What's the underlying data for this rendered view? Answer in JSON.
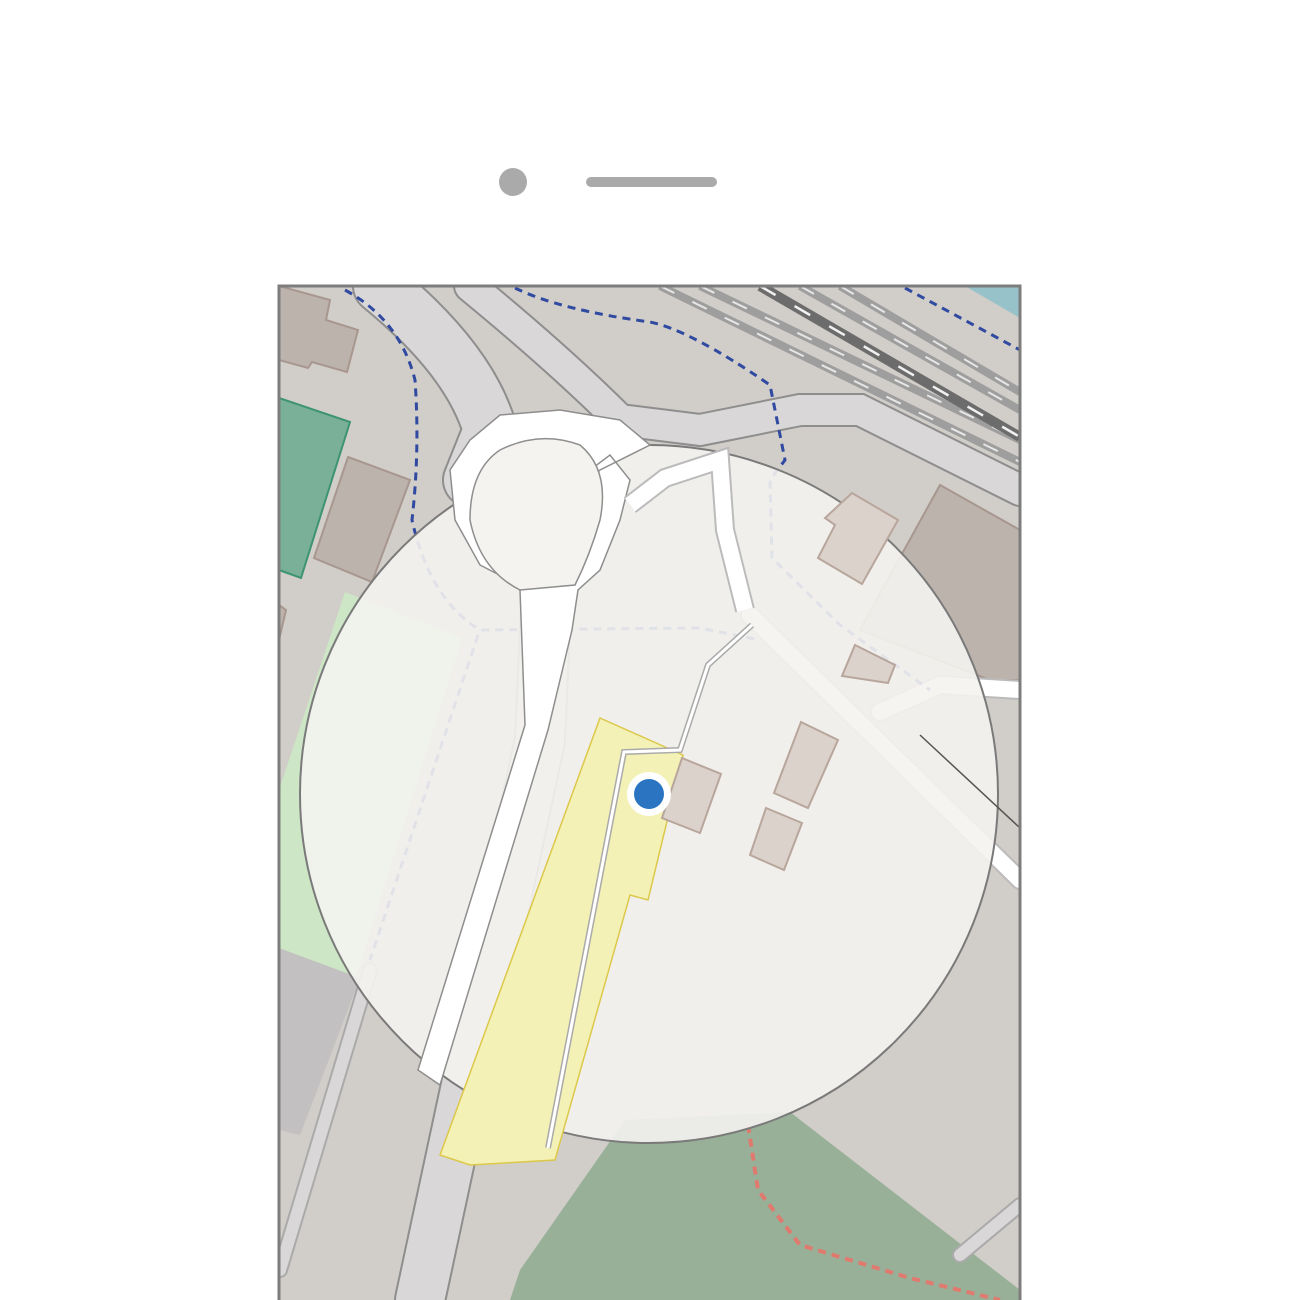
{
  "device": {
    "type": "phone-mockup",
    "camera_icon": "camera-dot",
    "speaker_icon": "speaker-slot"
  },
  "map": {
    "colors": {
      "background": "#d1cdc8",
      "building": "#bcb3ad",
      "building_light": "#dbd2cb",
      "park": "#79b097",
      "grass": "#cde6c6",
      "forest": "#98b098",
      "road": "#d9d7d8",
      "road_major": "#ffffff",
      "platform": "#f3f1b5",
      "rail": "#6c6c6c",
      "rail_light": "#9e9e9e",
      "water": "#97c2c9",
      "footway_blue": "#2f4aa0",
      "footway_red": "#e07a6e",
      "accuracy_circle": "#f4f3ef",
      "location_dot": "#2a74c2"
    },
    "location_marker": {
      "icon": "current-location-dot",
      "accuracy_circle_visible": true
    }
  }
}
